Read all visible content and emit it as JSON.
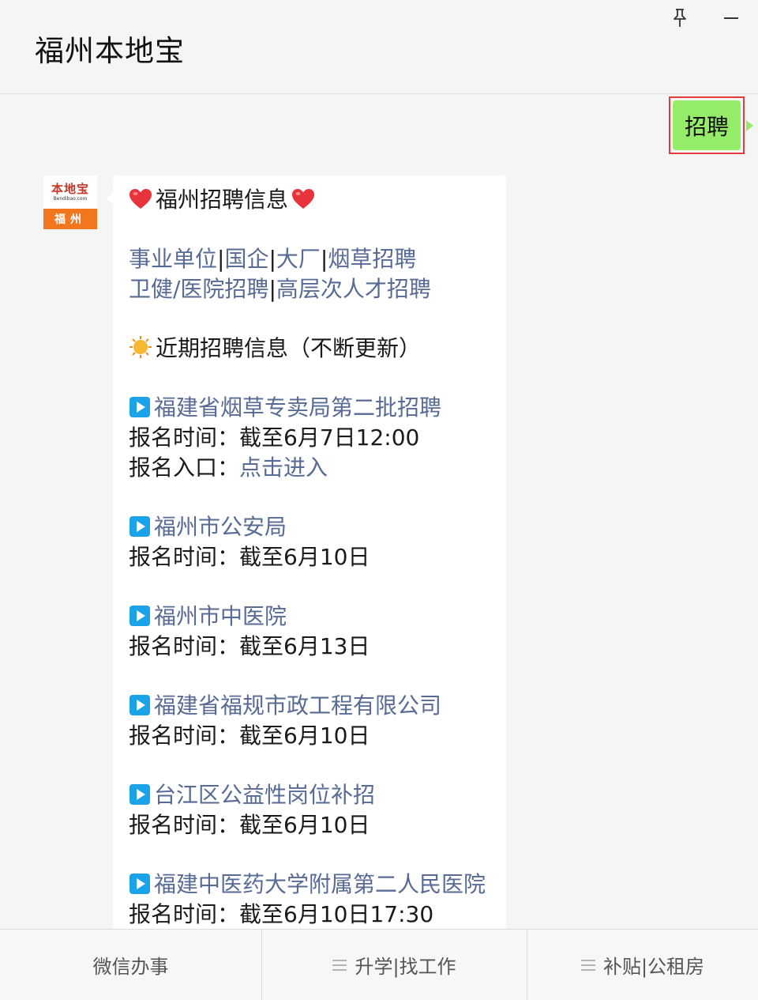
{
  "header": {
    "title": "福州本地宝",
    "pin_icon": "pin-icon",
    "minimize_icon": "minimize-icon"
  },
  "user_message": {
    "text": "招聘",
    "bubble_color": "#95ec69",
    "highlight_color": "#e23b3b"
  },
  "avatar": {
    "brand": "本地宝",
    "url": "Bendibao.com",
    "city": "福州",
    "accent": "#f2761e"
  },
  "reply": {
    "heading": "福州招聘信息",
    "heading_icon": "heart-icon",
    "categories_row1": [
      "事业单位",
      "国企",
      "大厂",
      "烟草招聘"
    ],
    "categories_row2": [
      "卫健/医院招聘",
      "高层次人才招聘"
    ],
    "recent_heading": "近期招聘信息（不断更新）",
    "recent_icon": "sun-icon",
    "jobs": [
      {
        "title": "福建省烟草专卖局第二批招聘",
        "time_label": "报名时间：",
        "time_value": "截至6月7日12:00",
        "entry_label": "报名入口：",
        "entry_link": "点击进入"
      },
      {
        "title": "福州市公安局",
        "time_label": "报名时间：",
        "time_value": "截至6月10日"
      },
      {
        "title": "福州市中医院",
        "time_label": "报名时间：",
        "time_value": "截至6月13日"
      },
      {
        "title": "福建省福规市政工程有限公司",
        "time_label": "报名时间：",
        "time_value": "截至6月10日"
      },
      {
        "title": "台江区公益性岗位补招",
        "time_label": "报名时间：",
        "time_value": "截至6月10日"
      },
      {
        "title": "福建中医药大学附属第二人民医院",
        "time_label": "报名时间：",
        "time_value": "截至6月10日17:30"
      }
    ],
    "link_color": "#576b95",
    "play_icon_color": "#1aa3e8"
  },
  "bottom_tabs": [
    {
      "label": "微信办事"
    },
    {
      "label": "升学|找工作",
      "icon": "menu-icon"
    },
    {
      "label": "补贴|公租房",
      "icon": "menu-icon"
    }
  ]
}
